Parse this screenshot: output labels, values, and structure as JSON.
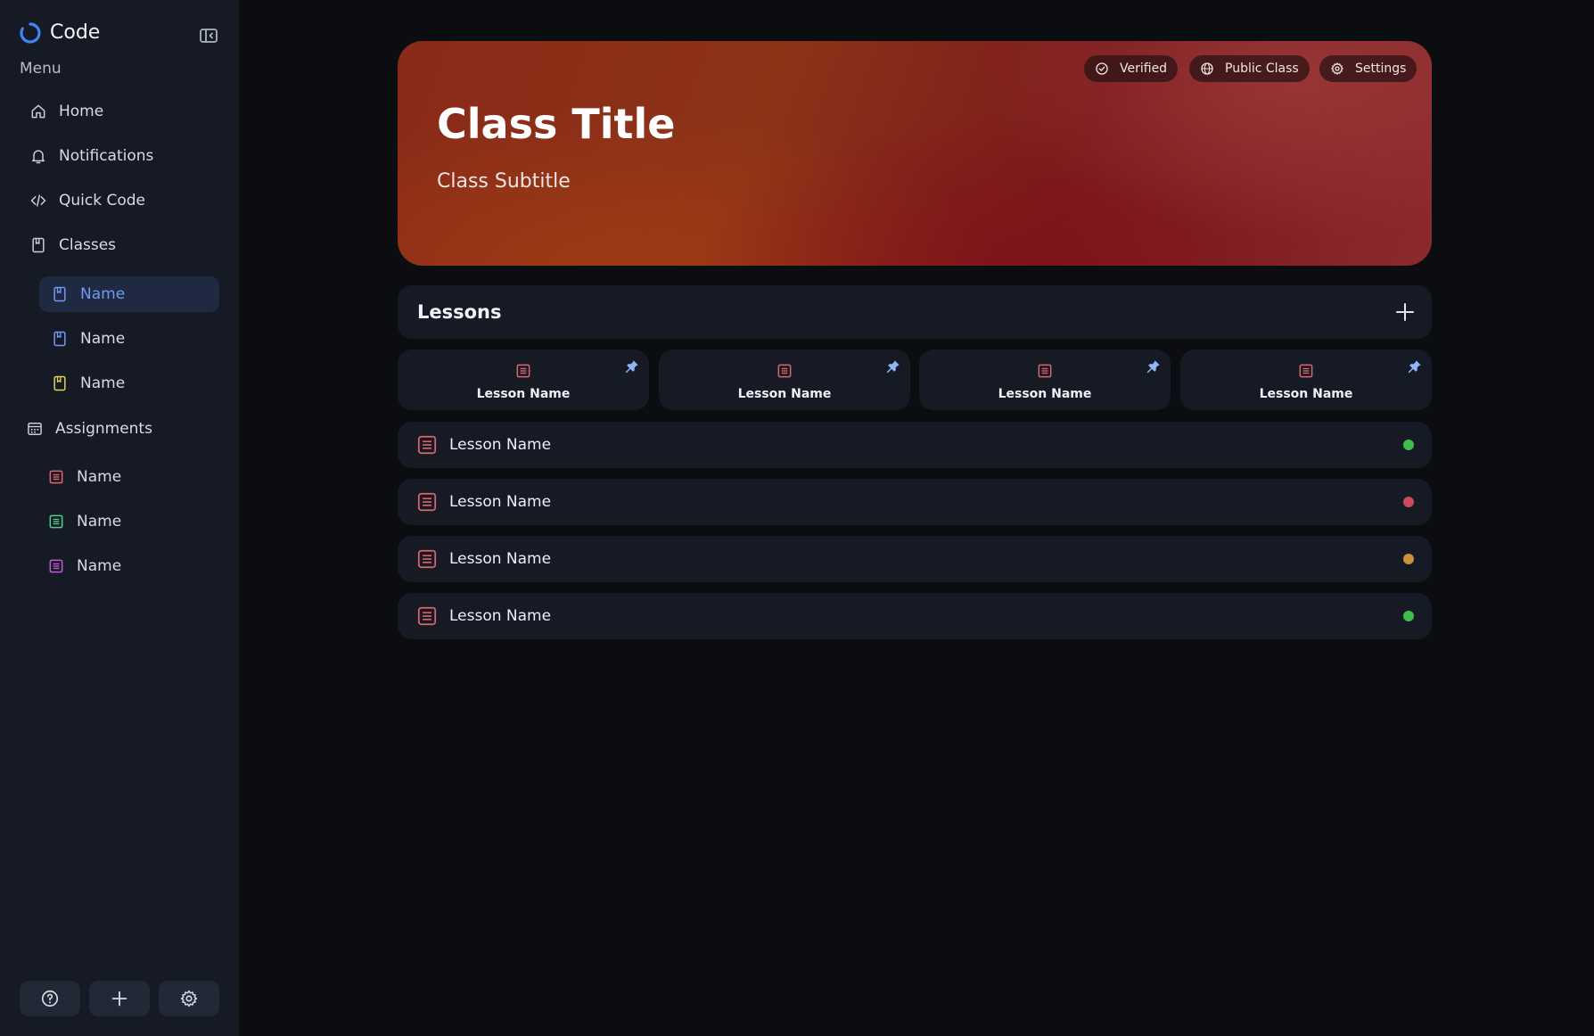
{
  "app": {
    "name": "Code",
    "menu_label": "Menu"
  },
  "nav": {
    "home": "Home",
    "notifications": "Notifications",
    "quick_code": "Quick Code",
    "classes": "Classes",
    "assignments": "Assignments"
  },
  "classes": [
    {
      "label": "Name",
      "color": "#6f9af0",
      "active": true
    },
    {
      "label": "Name",
      "color": "#6f9af0",
      "active": false
    },
    {
      "label": "Name",
      "color": "#e0d35a",
      "active": false
    }
  ],
  "assignments": [
    {
      "label": "Name",
      "color": "#e06470"
    },
    {
      "label": "Name",
      "color": "#4fd08a"
    },
    {
      "label": "Name",
      "color": "#c05ad8"
    }
  ],
  "bottom_actions": {
    "help": "help-icon",
    "add": "plus-icon",
    "settings": "gear-icon"
  },
  "hero": {
    "title": "Class Title",
    "subtitle": "Class Subtitle",
    "chips": {
      "verified": "Verified",
      "public": "Public Class",
      "settings": "Settings"
    }
  },
  "lessons": {
    "title": "Lessons",
    "pinned": [
      {
        "label": "Lesson Name"
      },
      {
        "label": "Lesson Name"
      },
      {
        "label": "Lesson Name"
      },
      {
        "label": "Lesson Name"
      }
    ],
    "list": [
      {
        "label": "Lesson Name",
        "status_color": "#3fbf4a"
      },
      {
        "label": "Lesson Name",
        "status_color": "#c94a58"
      },
      {
        "label": "Lesson Name",
        "status_color": "#c9913a"
      },
      {
        "label": "Lesson Name",
        "status_color": "#3fbf4a"
      }
    ]
  },
  "colors": {
    "accent": "#6f9af0",
    "lesson_icon": "#e0646a"
  }
}
